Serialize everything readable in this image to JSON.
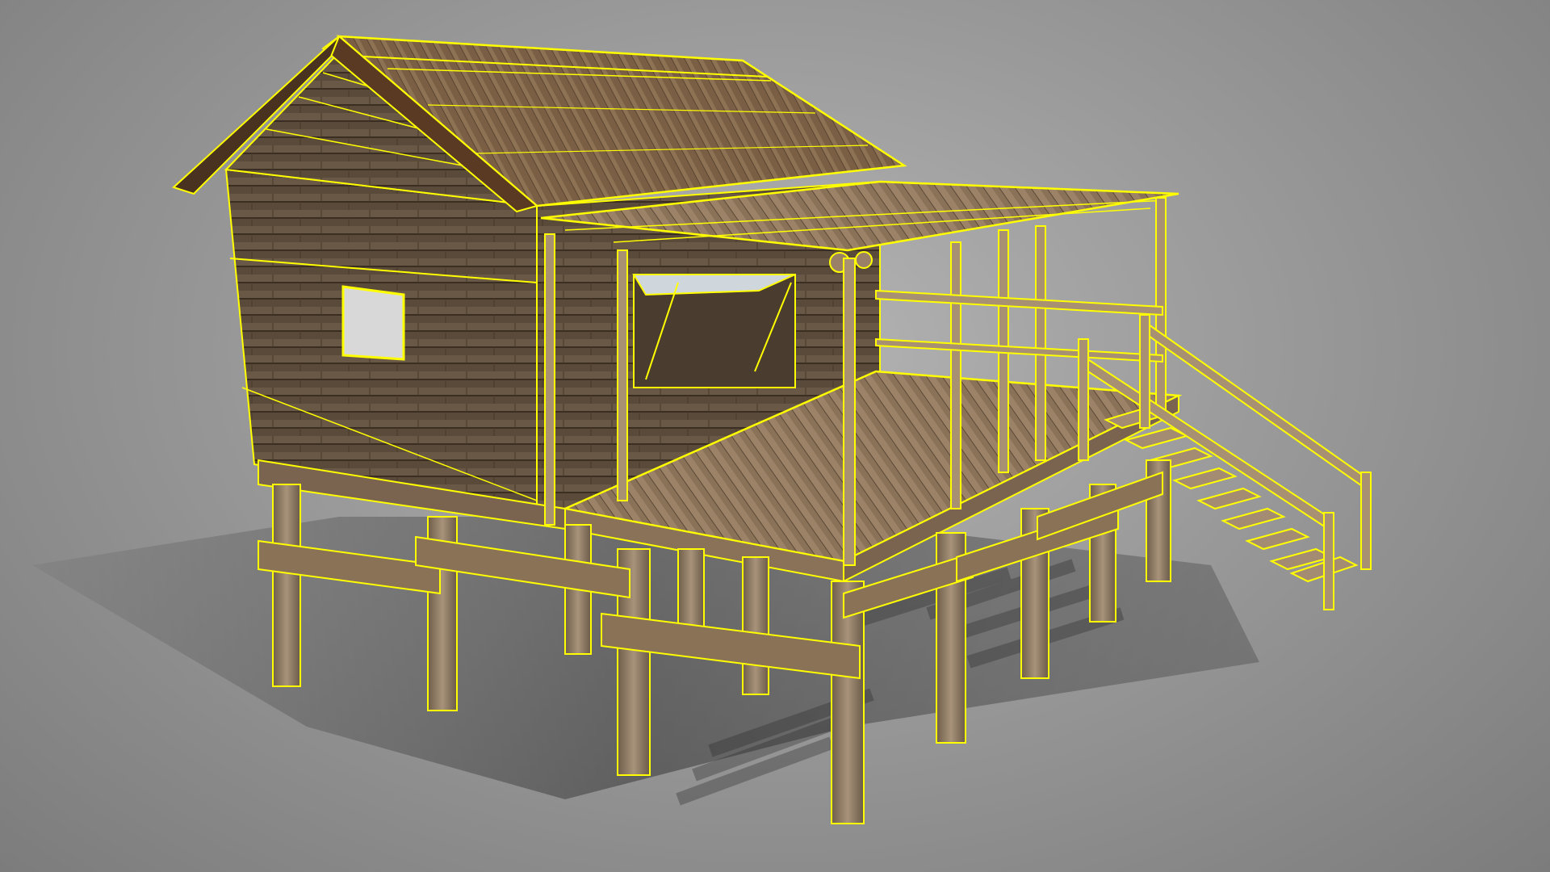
{
  "viewport": {
    "background_color": "#9e9e9e",
    "wireframe_color": "#ffff00"
  },
  "model": {
    "subject": "stilt-house",
    "selected": true,
    "display_mode": "textured-with-wireframe-overlay",
    "parts": [
      "roof",
      "gable-wall",
      "cabin-walls",
      "window-opening",
      "veranda-roof",
      "veranda-deck",
      "veranda-railing",
      "staircase",
      "stair-handrail",
      "stilts",
      "cross-beams",
      "ground-shadow"
    ]
  }
}
